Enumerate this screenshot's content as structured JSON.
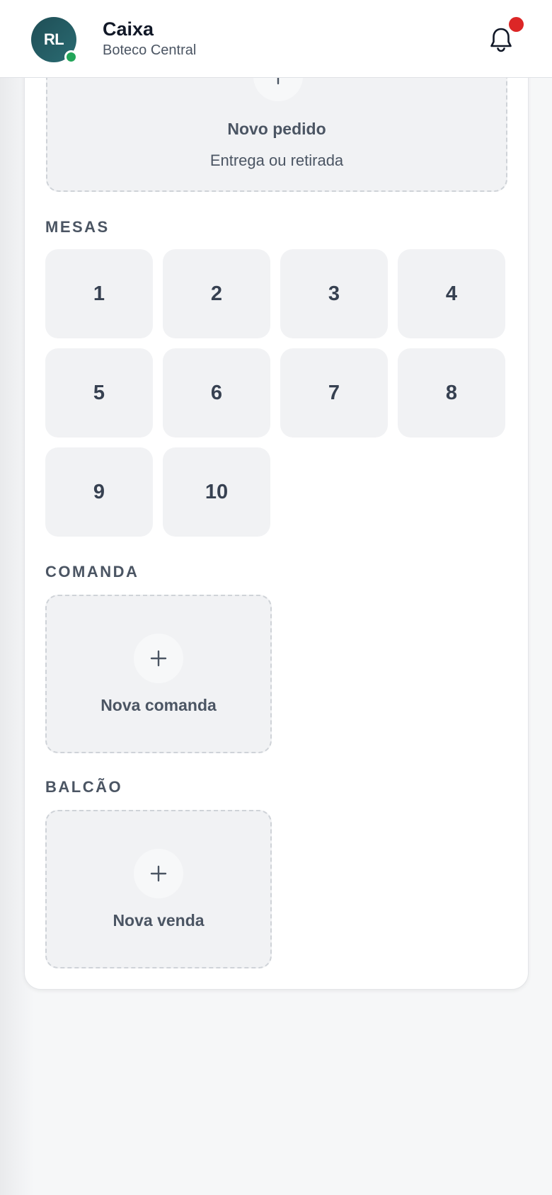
{
  "header": {
    "avatar_initials": "RL",
    "title": "Caixa",
    "subtitle": "Boteco Central",
    "has_notification": true,
    "accent_color": "#1f4e56",
    "online_color": "#22a559",
    "badge_color": "#dc2626"
  },
  "new_order": {
    "label": "Novo pedido",
    "sublabel": "Entrega ou retirada"
  },
  "sections": {
    "tables_title": "MESAS",
    "comanda_title": "COMANDA",
    "balcao_title": "BALCÃO"
  },
  "tables": [
    "1",
    "2",
    "3",
    "4",
    "5",
    "6",
    "7",
    "8",
    "9",
    "10"
  ],
  "comanda": {
    "label": "Nova comanda"
  },
  "balcao": {
    "label": "Nova venda"
  },
  "icons": {
    "notification": "bell-icon",
    "add": "plus-icon"
  }
}
